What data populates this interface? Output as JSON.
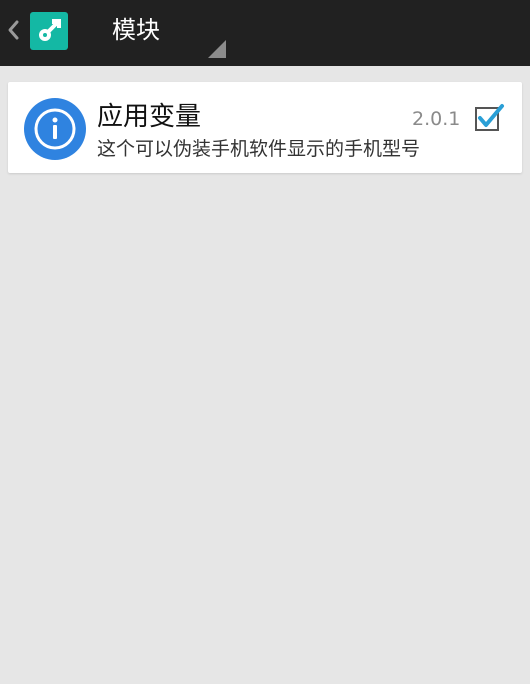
{
  "actionbar": {
    "title": "模块"
  },
  "module": {
    "name": "应用变量",
    "version": "2.0.1",
    "description": "这个可以伪装手机软件显示的手机型号",
    "enabled": true
  },
  "icons": {
    "back": "chevron-left-icon",
    "app": "xposed-installer-icon",
    "module": "info-icon",
    "checkbox": "checkbox-checked-icon",
    "spinner": "spinner-triangle-icon"
  },
  "colors": {
    "actionbar_bg": "#212121",
    "app_icon_bg": "#14b8a4",
    "module_icon_bg": "#2f83e0",
    "checkbox_accent": "#2a9fd6",
    "page_bg": "#e6e6e6"
  }
}
